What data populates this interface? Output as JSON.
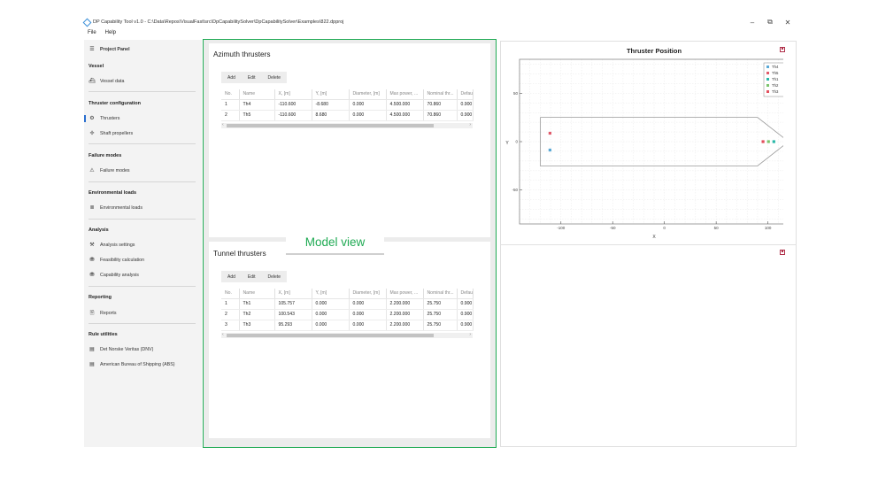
{
  "window": {
    "title": "DP Capability Tool v1.0 - C:\\Data\\Repos\\VisualFast\\src\\DpCapabilitySolver\\DpCapabilitySolver\\Examples\\822.dpproj",
    "minimize_glyph": "–",
    "maximize_glyph": "⧉",
    "close_glyph": "✕"
  },
  "menu": [
    "File",
    "Help"
  ],
  "sidebar": {
    "panel_title": "Project Panel",
    "sections": [
      {
        "heading": "Vessel",
        "items": [
          {
            "label": "Vessel data",
            "icon": "ship-icon"
          }
        ]
      },
      {
        "heading": "Thruster configuration",
        "items": [
          {
            "label": "Thrusters",
            "icon": "thruster-icon",
            "selected": true
          },
          {
            "label": "Shaft propellers",
            "icon": "propeller-icon"
          }
        ]
      },
      {
        "heading": "Failure modes",
        "items": [
          {
            "label": "Failure modes",
            "icon": "failure-icon"
          }
        ]
      },
      {
        "heading": "Environmental loads",
        "items": [
          {
            "label": "Environmental loads",
            "icon": "waves-icon"
          }
        ]
      },
      {
        "heading": "Analysis",
        "items": [
          {
            "label": "Analysis settings",
            "icon": "settings-icon"
          },
          {
            "label": "Feasibility calculation",
            "icon": "calculation-icon"
          },
          {
            "label": "Capability analysis",
            "icon": "analysis-icon"
          }
        ]
      },
      {
        "heading": "Reporting",
        "items": [
          {
            "label": "Reports",
            "icon": "report-icon"
          }
        ]
      },
      {
        "heading": "Rule utilities",
        "items": [
          {
            "label": "Det Norske Veritas (DNV)",
            "icon": "rulebook-icon"
          },
          {
            "label": "American Bureau of Shipping (ABS)",
            "icon": "rulebook-icon"
          }
        ]
      }
    ]
  },
  "azimuth": {
    "title": "Azimuth thrusters",
    "toolbar": [
      "Add",
      "Edit",
      "Delete"
    ],
    "columns": [
      "No.",
      "Name",
      "X, [m]",
      "Y, [m]",
      "Diameter, [m]",
      "Max power, ...",
      "Nominal thr...",
      "Default t"
    ],
    "rows": [
      [
        "1",
        "Th4",
        "-110.600",
        "-8.680",
        "0.000",
        "4.500.000",
        "70.860",
        "0.900"
      ],
      [
        "2",
        "Th5",
        "-110.600",
        "8.680",
        "0.000",
        "4.500.000",
        "70.860",
        "0.900"
      ]
    ]
  },
  "tunnel": {
    "title": "Tunnel thrusters",
    "toolbar": [
      "Add",
      "Edit",
      "Delete"
    ],
    "columns": [
      "No.",
      "Name",
      "X, [m]",
      "Y, [m]",
      "Diameter, [m]",
      "Max power, ...",
      "Nominal thr...",
      "Default t"
    ],
    "rows": [
      [
        "1",
        "Th1",
        "105.757",
        "0.000",
        "0.000",
        "2.200.000",
        "25.750",
        "0.900"
      ],
      [
        "2",
        "Th2",
        "100.543",
        "0.000",
        "0.000",
        "2.200.000",
        "25.750",
        "0.900"
      ],
      [
        "3",
        "Th3",
        "95.293",
        "0.000",
        "0.000",
        "2.200.000",
        "25.750",
        "0.900"
      ]
    ]
  },
  "annotation": {
    "label": "Model view"
  },
  "accent_color": "#1faa53",
  "chart_data": {
    "type": "scatter",
    "title": "Thruster Position",
    "xlabel": "X",
    "ylabel": "Y",
    "xlim": [
      -140,
      120
    ],
    "ylim": [
      -85,
      85
    ],
    "x_ticks": [
      -100,
      -50,
      0,
      50,
      100
    ],
    "y_ticks": [
      -50,
      0,
      50
    ],
    "grid": true,
    "legend_position": "top-right",
    "series": [
      {
        "name": "Th4",
        "color": "#5aa9d6",
        "x": [
          -110.6
        ],
        "y": [
          -8.68
        ]
      },
      {
        "name": "Th5",
        "color": "#e05b6a",
        "x": [
          -110.6
        ],
        "y": [
          8.68
        ]
      },
      {
        "name": "Th1",
        "color": "#2ab8a8",
        "x": [
          105.757
        ],
        "y": [
          0
        ]
      },
      {
        "name": "Th2",
        "color": "#7cc46d",
        "x": [
          100.543
        ],
        "y": [
          0
        ]
      },
      {
        "name": "Th3",
        "color": "#e3505e",
        "x": [
          95.293
        ],
        "y": [
          0
        ]
      }
    ],
    "hull_outline": {
      "x": [
        -120,
        90,
        120,
        90,
        -120,
        -120
      ],
      "y": [
        25,
        25,
        0,
        -25,
        -25,
        25
      ]
    }
  }
}
